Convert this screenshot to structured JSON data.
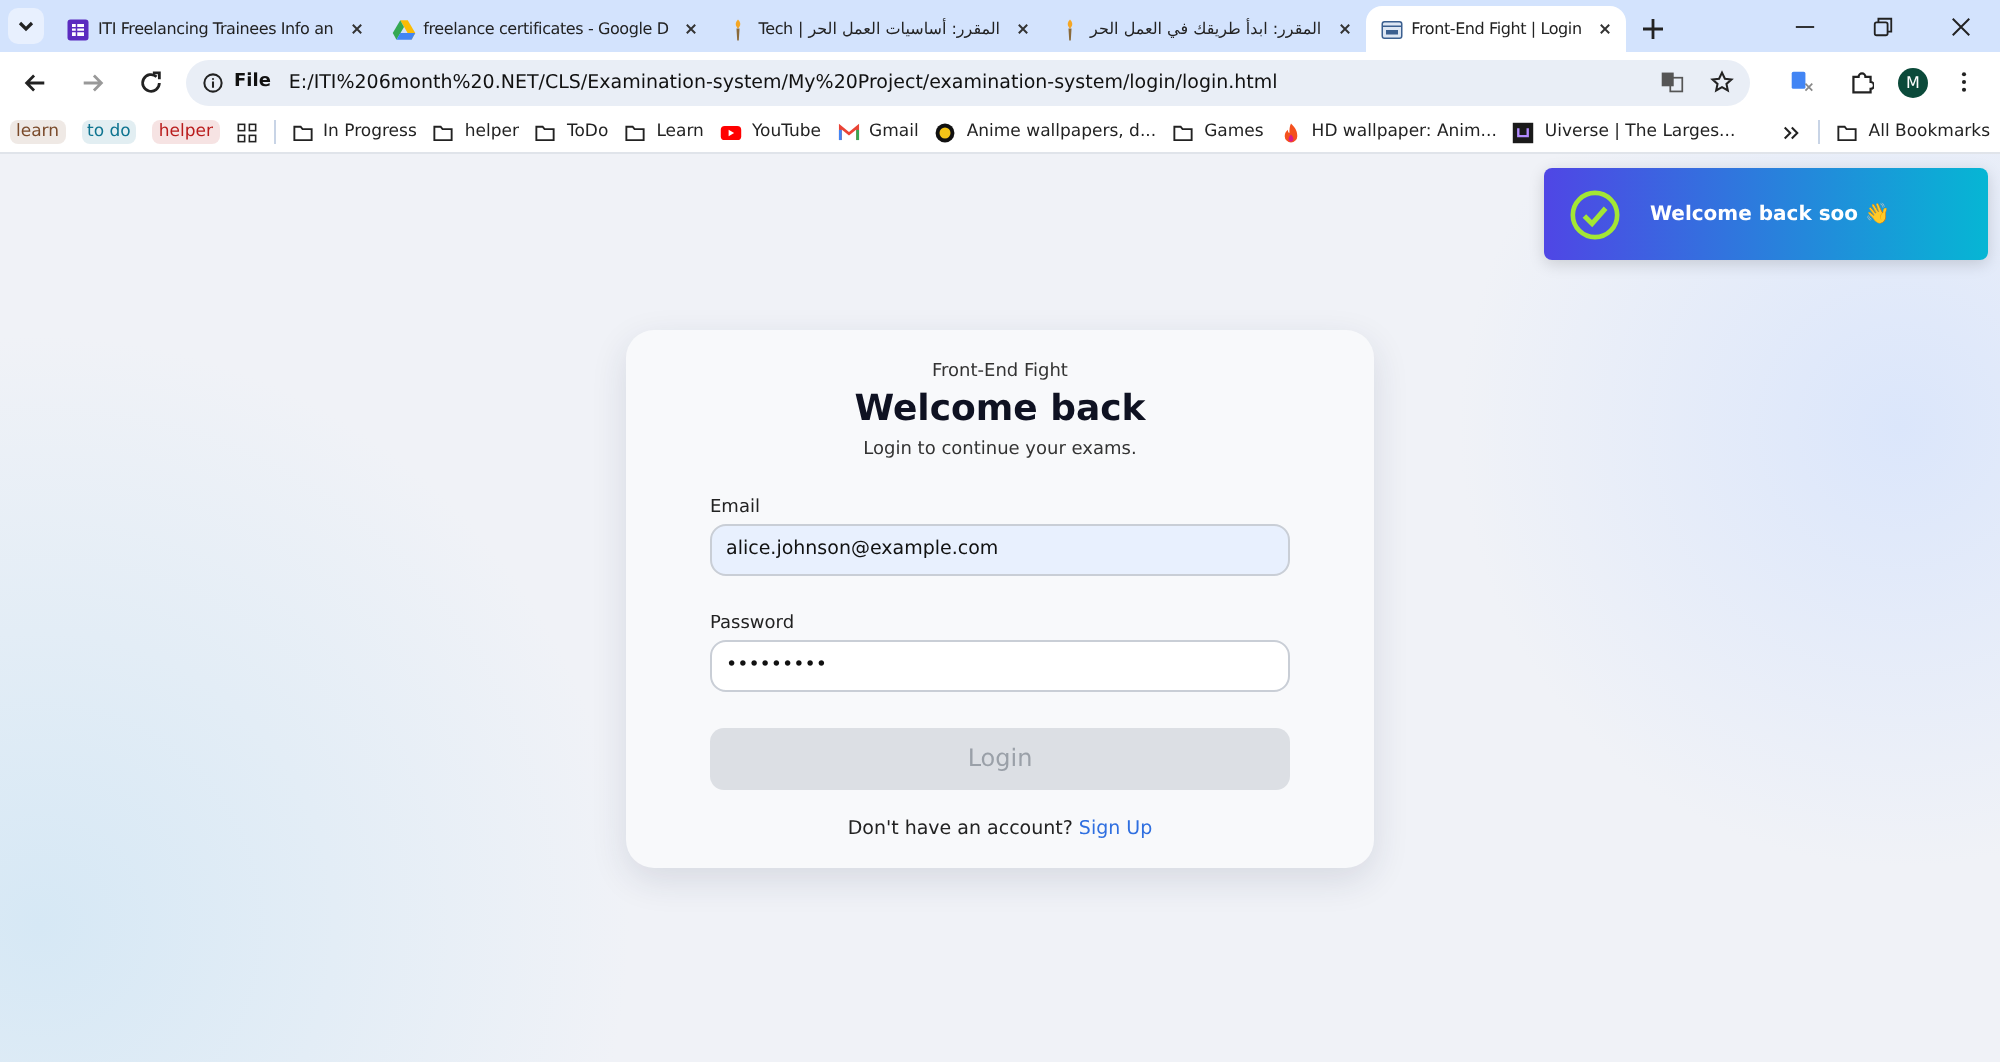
{
  "tabs": [
    {
      "title": "ITI Freelancing Trainees Info an",
      "kind": "form",
      "selected": false
    },
    {
      "title": "freelance certificates - Google D",
      "kind": "drive",
      "selected": false
    },
    {
      "title": "المقرر: أساسيات العمل الحر | Tech",
      "kind": "torch",
      "selected": false
    },
    {
      "title": "المقرر: ابدأ طريقك في العمل الحر",
      "kind": "torch",
      "selected": false
    },
    {
      "title": "Front-End Fight | Login",
      "kind": "page",
      "selected": true
    }
  ],
  "address_bar": {
    "scheme": "File",
    "url": "E:/ITI%206month%20.NET/CLS/Examination-system/My%20Project/examination-system/login/login.html"
  },
  "bookmarks": [
    {
      "kind": "chip",
      "label": "learn",
      "color": "#7a4a2a"
    },
    {
      "kind": "chip",
      "label": "to do",
      "color": "#0e7490"
    },
    {
      "kind": "chip",
      "label": "helper",
      "color": "#b91c1c"
    },
    {
      "kind": "apps"
    },
    {
      "kind": "folder",
      "label": "In Progress"
    },
    {
      "kind": "folder",
      "label": "helper"
    },
    {
      "kind": "folder",
      "label": "ToDo"
    },
    {
      "kind": "folder",
      "label": "Learn"
    },
    {
      "kind": "youtube",
      "label": "YouTube"
    },
    {
      "kind": "gmail",
      "label": "Gmail"
    },
    {
      "kind": "coin",
      "label": "Anime wallpapers, d..."
    },
    {
      "kind": "folder",
      "label": "Games"
    },
    {
      "kind": "flame",
      "label": "HD wallpaper: Anim..."
    },
    {
      "kind": "uiverse",
      "label": "Uiverse | The Larges..."
    }
  ],
  "all_bookmarks": "All Bookmarks",
  "profile_initial": "M",
  "toast": {
    "message": "Welcome back soo 👋"
  },
  "login": {
    "brand": "Front-End Fight",
    "title": "Welcome back",
    "subtitle": "Login to continue your exams.",
    "email": {
      "label": "Email",
      "value": "alice.johnson@example.com"
    },
    "password": {
      "label": "Password",
      "value": "•••••••••"
    },
    "button": {
      "label": "Login",
      "disabled": true
    },
    "footer": {
      "text": "Don't have an account?",
      "link": "Sign Up"
    }
  }
}
